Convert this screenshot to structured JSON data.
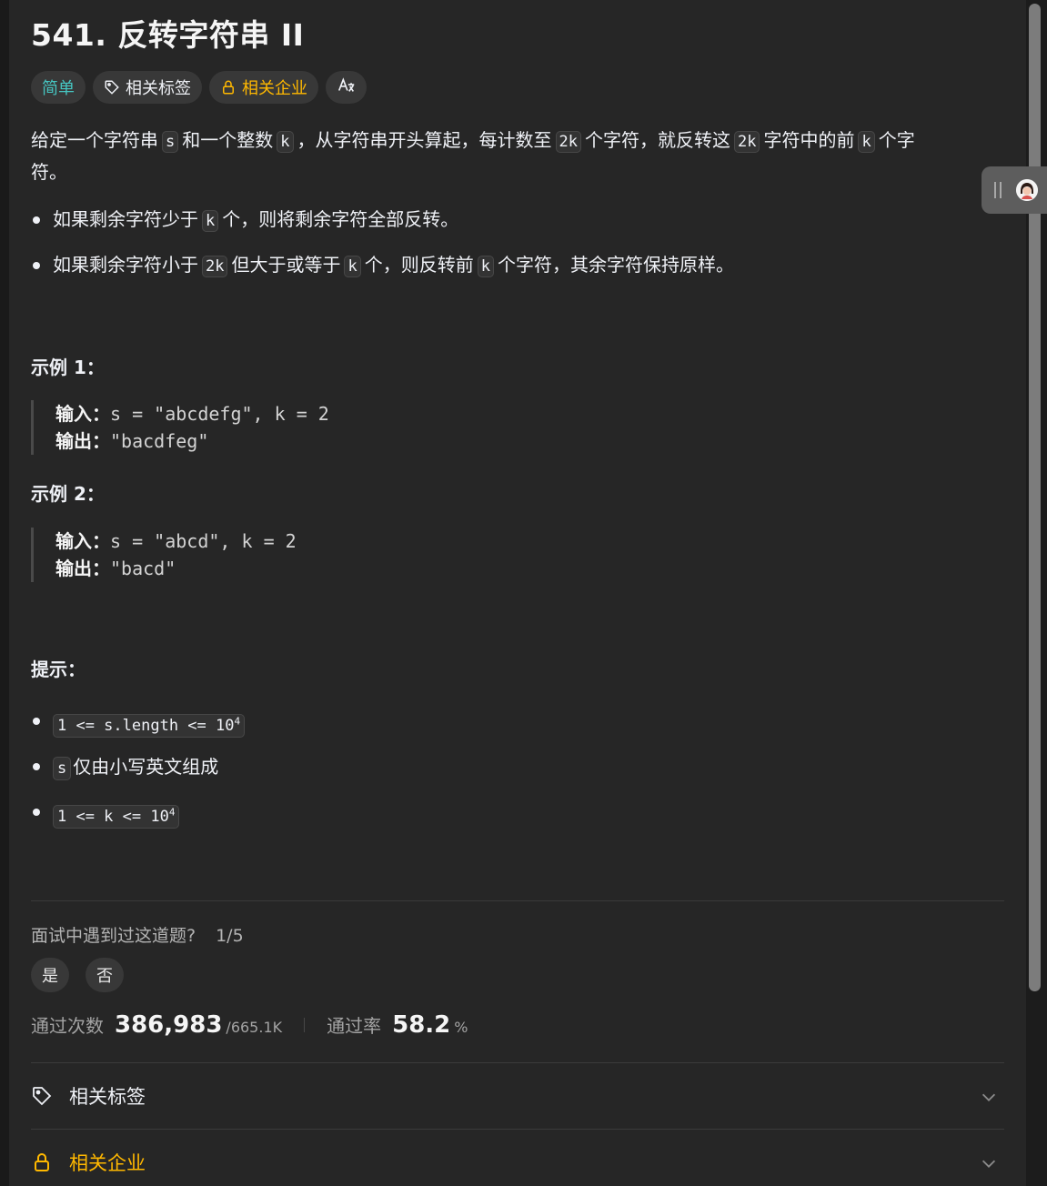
{
  "problem": {
    "title": "541. 反转字符串 II",
    "tags": {
      "difficulty": "简单",
      "related_tags": "相关标签",
      "related_companies": "相关企业"
    },
    "description": {
      "p1": "给定一个字符串",
      "code_s": "s",
      "p2": "和一个整数",
      "code_k": "k",
      "p3": "，从字符串开头算起，每计数至",
      "code_2k": "2k",
      "p4": "个字符，就反转这",
      "p5": "字符中的前",
      "p6": "个字",
      "p7": "符。"
    },
    "rules": [
      {
        "a": "如果剩余字符少于",
        "code1": "k",
        "b": "个，则将剩余字符全部反转。"
      },
      {
        "a": "如果剩余字符小于",
        "code1": "2k",
        "b": "但大于或等于",
        "code2": "k",
        "c": "个，则反转前",
        "code3": "k",
        "d": "个字符，其余字符保持原样。"
      }
    ],
    "examples": [
      {
        "title": "示例 1：",
        "input_label": "输入：",
        "input": "s = \"abcdefg\", k = 2",
        "output_label": "输出：",
        "output": "\"bacdfeg\""
      },
      {
        "title": "示例 2：",
        "input_label": "输入：",
        "input": "s = \"abcd\", k = 2",
        "output_label": "输出：",
        "output": "\"bacd\""
      }
    ],
    "hints_title": "提示：",
    "hints": [
      {
        "code": "1 <= s.length <= 10",
        "sup": "4"
      },
      {
        "code": "s",
        "text": "仅由小写英文组成"
      },
      {
        "code": "1 <= k <= 10",
        "sup": "4"
      }
    ]
  },
  "interview": {
    "question": "面试中遇到过这道题?",
    "fraction": "1/5",
    "yes": "是",
    "no": "否"
  },
  "stats": {
    "accepted_label": "通过次数",
    "accepted": "386,983",
    "submissions": "/665.1K",
    "rate_label": "通过率",
    "rate": "58.2",
    "rate_unit": "%"
  },
  "sections": {
    "tags": "相关标签",
    "companies": "相关企业"
  },
  "colors": {
    "easy": "#46c6c2",
    "company": "#ffb800",
    "background": "#262626"
  }
}
